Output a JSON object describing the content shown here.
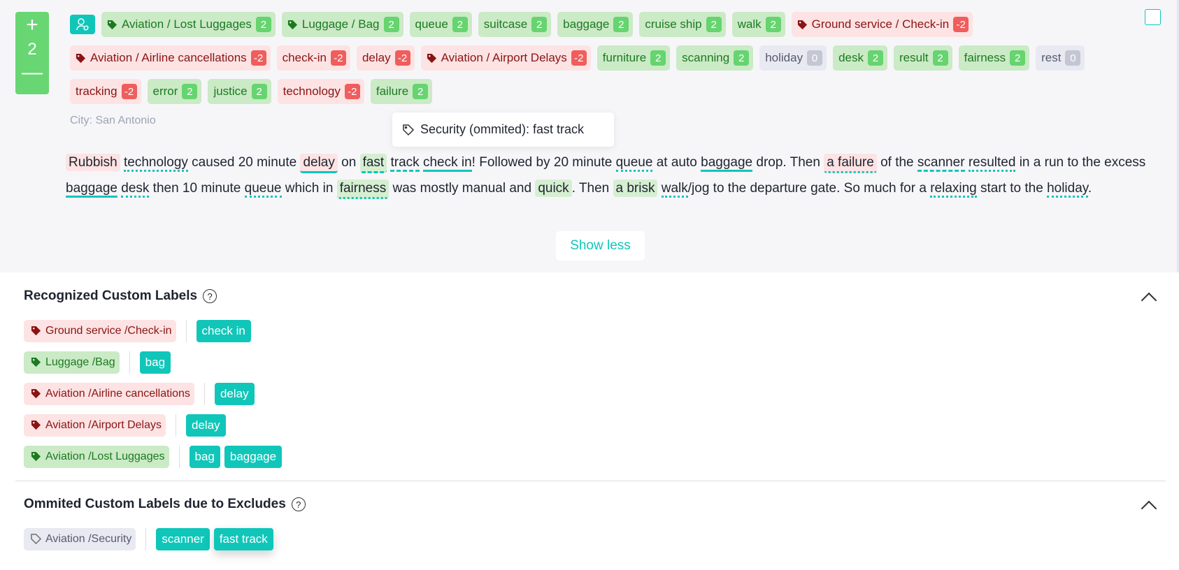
{
  "vote": {
    "plus": "+",
    "score": "2",
    "minus": "—"
  },
  "tags": [
    {
      "label": "Aviation / Lost Luggages",
      "score": "2",
      "type": "pos",
      "icon": "tag"
    },
    {
      "label": "Luggage / Bag",
      "score": "2",
      "type": "pos",
      "icon": "tag"
    },
    {
      "label": "queue",
      "score": "2",
      "type": "pos"
    },
    {
      "label": "suitcase",
      "score": "2",
      "type": "pos"
    },
    {
      "label": "baggage",
      "score": "2",
      "type": "pos"
    },
    {
      "label": "cruise ship",
      "score": "2",
      "type": "pos"
    },
    {
      "label": "walk",
      "score": "2",
      "type": "pos"
    },
    {
      "label": "Ground service / Check-in",
      "score": "-2",
      "type": "neg",
      "icon": "tag"
    },
    {
      "label": "Aviation / Airline cancellations",
      "score": "-2",
      "type": "neg",
      "icon": "tag"
    },
    {
      "label": "check-in",
      "score": "-2",
      "type": "neg"
    },
    {
      "label": "delay",
      "score": "-2",
      "type": "neg"
    },
    {
      "label": "Aviation / Airport Delays",
      "score": "-2",
      "type": "neg",
      "icon": "tag"
    },
    {
      "label": "furniture",
      "score": "2",
      "type": "pos"
    },
    {
      "label": "scanning",
      "score": "2",
      "type": "pos"
    },
    {
      "label": "holiday",
      "score": "0",
      "type": "neu"
    },
    {
      "label": "desk",
      "score": "2",
      "type": "pos"
    },
    {
      "label": "result",
      "score": "2",
      "type": "pos"
    },
    {
      "label": "fairness",
      "score": "2",
      "type": "pos"
    },
    {
      "label": "rest",
      "score": "0",
      "type": "neu"
    },
    {
      "label": "tracking",
      "score": "-2",
      "type": "neg"
    },
    {
      "label": "error",
      "score": "2",
      "type": "pos"
    },
    {
      "label": "justice",
      "score": "2",
      "type": "pos"
    },
    {
      "label": "technology",
      "score": "-2",
      "type": "neg"
    },
    {
      "label": "failure",
      "score": "2",
      "type": "pos"
    }
  ],
  "city": "City: San Antonio",
  "tooltip": "Security (ommited): fast track",
  "review": [
    {
      "t": "Rubbish",
      "c": "s neg"
    },
    {
      "t": " "
    },
    {
      "t": "technology",
      "c": "d"
    },
    {
      "t": " caused 20 minute "
    },
    {
      "t": "delay",
      "c": "s neg u"
    },
    {
      "t": " on "
    },
    {
      "t": "fast",
      "c": "s pos dash"
    },
    {
      "t": " "
    },
    {
      "t": "track",
      "c": "dash"
    },
    {
      "t": " "
    },
    {
      "t": "check in",
      "c": "u"
    },
    {
      "t": "! Followed by 20 minute "
    },
    {
      "t": "queue",
      "c": "d"
    },
    {
      "t": " at auto "
    },
    {
      "t": "baggage",
      "c": "u"
    },
    {
      "t": " drop. Then "
    },
    {
      "t": "a failure",
      "c": "s neg d"
    },
    {
      "t": " of the "
    },
    {
      "t": "scanner",
      "c": "dash"
    },
    {
      "t": " "
    },
    {
      "t": "resulted",
      "c": "d"
    },
    {
      "t": " in a run to the excess "
    },
    {
      "t": "baggage",
      "c": "u"
    },
    {
      "t": " "
    },
    {
      "t": "desk",
      "c": "d"
    },
    {
      "t": " then 10 minute "
    },
    {
      "t": "queue",
      "c": "d"
    },
    {
      "t": " which in "
    },
    {
      "t": "fairness",
      "c": "s pos d"
    },
    {
      "t": " was mostly manual and "
    },
    {
      "t": "quick",
      "c": "s pos"
    },
    {
      "t": ". Then "
    },
    {
      "t": "a brisk",
      "c": "s pos"
    },
    {
      "t": " "
    },
    {
      "t": "walk",
      "c": "d"
    },
    {
      "t": "/jog to the departure gate. So much for a "
    },
    {
      "t": "relaxing",
      "c": "d"
    },
    {
      "t": " start to the "
    },
    {
      "t": "holiday",
      "c": "d"
    },
    {
      "t": "."
    }
  ],
  "show_less": "Show less",
  "recognized": {
    "title": "Recognized Custom Labels",
    "help": "?",
    "rows": [
      {
        "label": "Ground service /Check-in",
        "type": "neg",
        "kws": [
          "check in"
        ]
      },
      {
        "label": "Luggage /Bag",
        "type": "pos",
        "kws": [
          "bag"
        ]
      },
      {
        "label": "Aviation /Airline cancellations",
        "type": "neg",
        "kws": [
          "delay"
        ]
      },
      {
        "label": "Aviation /Airport Delays",
        "type": "neg",
        "kws": [
          "delay"
        ]
      },
      {
        "label": "Aviation /Lost Luggages",
        "type": "pos",
        "kws": [
          "bag",
          "baggage"
        ]
      }
    ]
  },
  "omitted": {
    "title": "Ommited Custom Labels due to Excludes",
    "help": "?",
    "rows": [
      {
        "label": "Aviation /Security",
        "type": "neu",
        "kws": [
          "scanner",
          "fast track"
        ]
      }
    ]
  },
  "colors": {
    "accent": "#10c6b9",
    "positive": "#66d46f",
    "negative": "#ef5d5d"
  }
}
